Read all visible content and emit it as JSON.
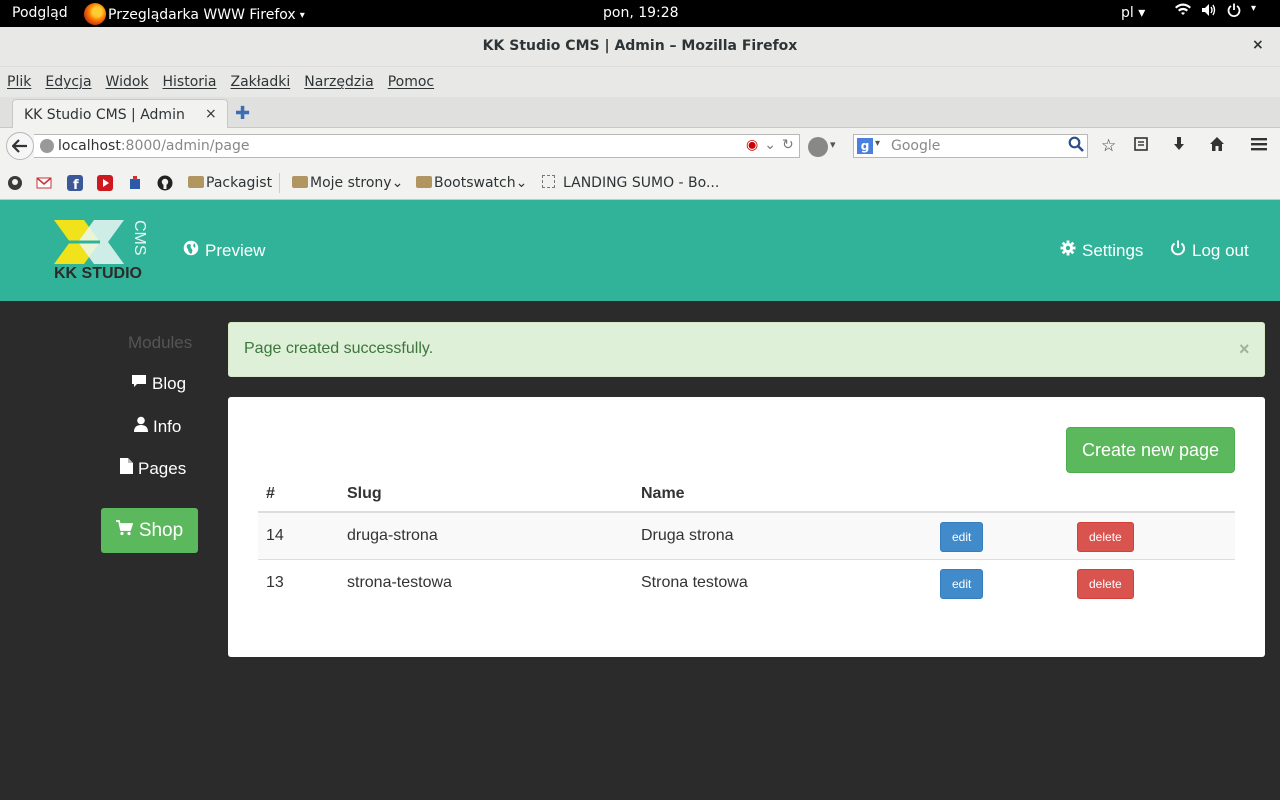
{
  "os": {
    "activities": "Podgląd",
    "app_name": "Przeglądarka WWW Firefox",
    "app_caret": "▾",
    "clock": "pon, 19:28",
    "lang": "pl ▾"
  },
  "window": {
    "title": "KK Studio CMS | Admin – Mozilla Firefox",
    "close": "×"
  },
  "menu": [
    "Plik",
    "Edycja",
    "Widok",
    "Historia",
    "Zakładki",
    "Narzędzia",
    "Pomoc"
  ],
  "tab": {
    "label": "KK Studio CMS | Admin",
    "close": "×",
    "new": "✚"
  },
  "url": {
    "host": "localhost",
    "rest": ":8000/admin/page"
  },
  "search": {
    "placeholder": "Google",
    "engine_letter": "g"
  },
  "bookmarks": {
    "packagist": "Packagist",
    "moje_strony": "Moje strony",
    "bootswatch": "Bootswatch",
    "landing": "LANDING SUMO - Bo...",
    "caret": "⌄"
  },
  "brand": {
    "name": "KK STUDIO",
    "cms": "CMS"
  },
  "header": {
    "preview": "Preview",
    "settings": "Settings",
    "logout": "Log out"
  },
  "sidebar": {
    "title": "Modules",
    "items": [
      "Blog",
      "Info",
      "Pages"
    ],
    "shop": "Shop"
  },
  "alert": {
    "message": "Page created successfully.",
    "close": "×"
  },
  "panel": {
    "create_label": "Create new page",
    "columns": [
      "#",
      "Slug",
      "Name"
    ],
    "rows": [
      {
        "id": "14",
        "slug": "druga-strona",
        "name": "Druga strona",
        "edit": "edit",
        "delete": "delete"
      },
      {
        "id": "13",
        "slug": "strona-testowa",
        "name": "Strona testowa",
        "edit": "edit",
        "delete": "delete"
      }
    ]
  },
  "colors": {
    "header_bg": "#30b399",
    "page_bg": "#2b2b2b",
    "success": "#5cb85c",
    "primary": "#428bca",
    "danger": "#d9534f"
  }
}
